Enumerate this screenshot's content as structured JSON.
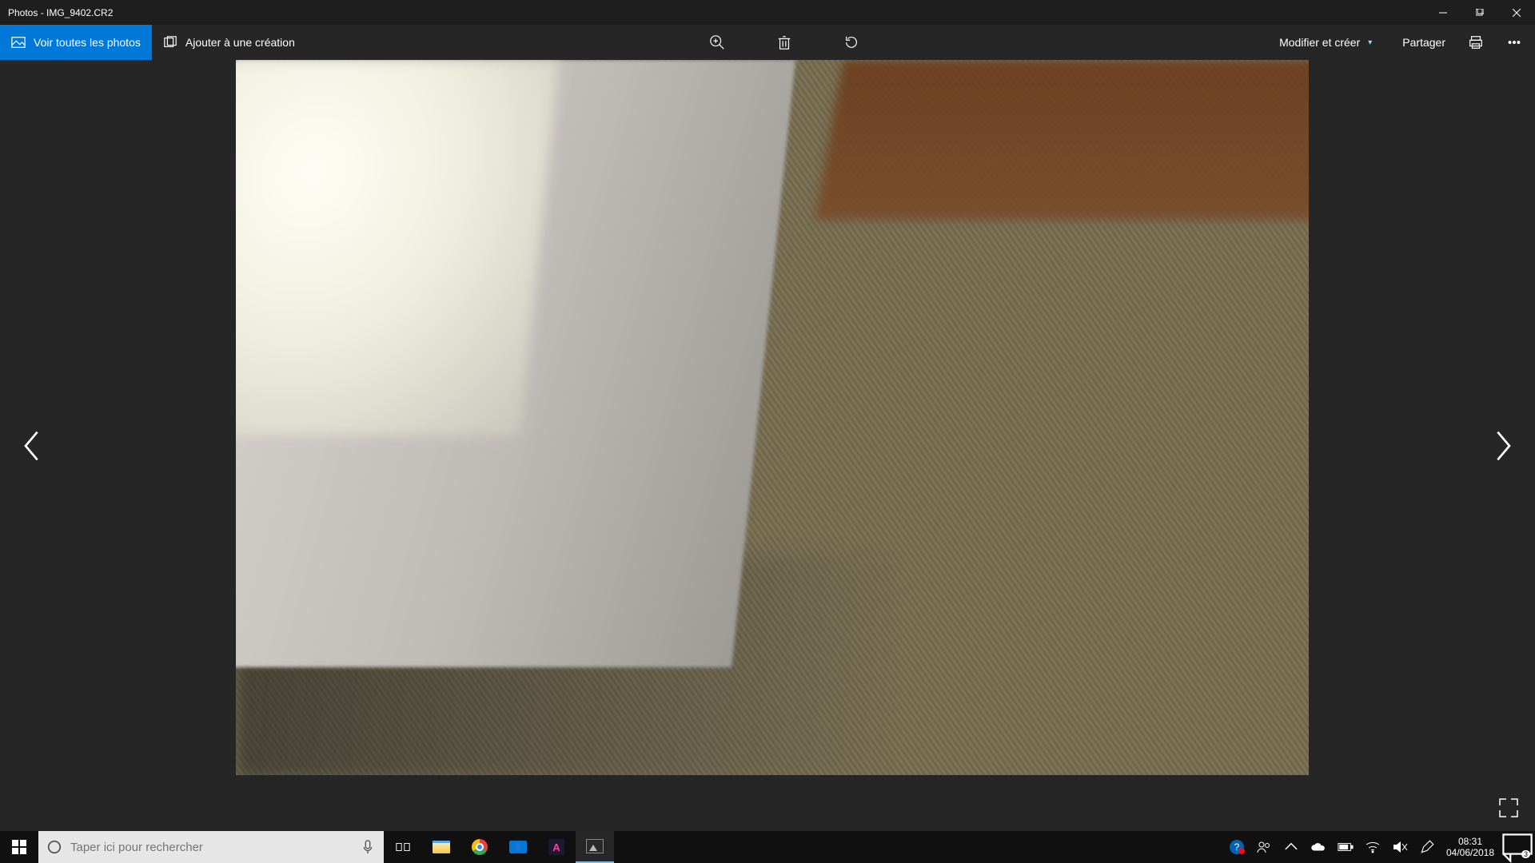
{
  "window": {
    "title": "Photos - IMG_9402.CR2"
  },
  "toolbar": {
    "view_all": "Voir toutes les photos",
    "add_creation": "Ajouter à une création",
    "edit_create": "Modifier et créer",
    "share": "Partager"
  },
  "taskbar": {
    "search_placeholder": "Taper ici pour rechercher",
    "clock_time": "08:31",
    "clock_date": "04/06/2018",
    "notif_count": "3"
  }
}
